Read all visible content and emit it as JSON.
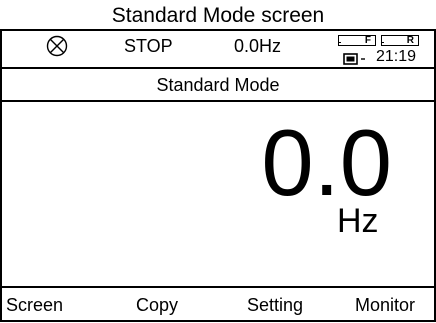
{
  "caption": "Standard Mode screen",
  "status": {
    "icon": "circle-x-icon",
    "run_state": "STOP",
    "frequency": "0.0Hz",
    "direction_forward": "F",
    "direction_reverse": "R",
    "battery_icon": "battery-icon",
    "clock": "21:19"
  },
  "title": "Standard Mode",
  "display": {
    "value": "0.0",
    "unit": "Hz"
  },
  "softkeys": {
    "screen": "Screen",
    "copy": "Copy",
    "setting": "Setting",
    "monitor": "Monitor"
  }
}
